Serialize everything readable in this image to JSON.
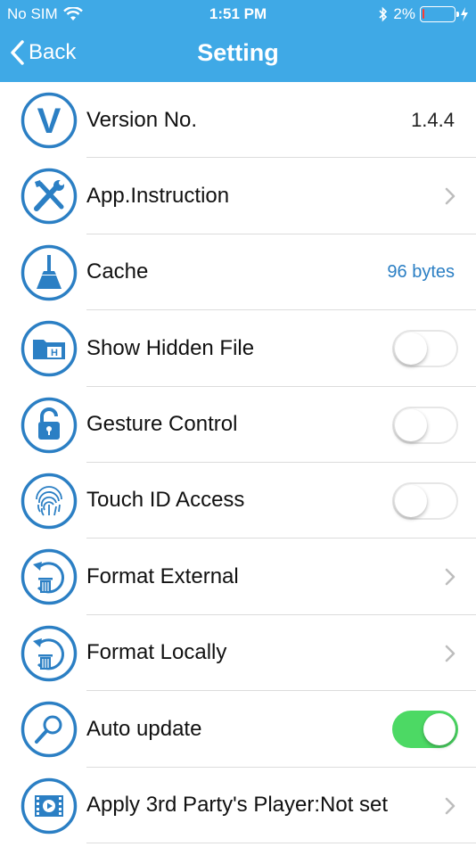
{
  "status_bar": {
    "carrier": "No SIM",
    "time": "1:51 PM",
    "battery": "2%"
  },
  "nav": {
    "back_label": "Back",
    "title": "Setting"
  },
  "rows": [
    {
      "label": "Version No.",
      "value": "1.4.4",
      "icon": "version-v-icon"
    },
    {
      "label": "App.Instruction",
      "icon": "tools-icon"
    },
    {
      "label": "Cache",
      "value": "96 bytes",
      "icon": "broom-icon"
    },
    {
      "label": "Show Hidden File",
      "toggle": false,
      "icon": "hidden-folder-icon"
    },
    {
      "label": "Gesture Control",
      "toggle": false,
      "icon": "lock-icon"
    },
    {
      "label": "Touch ID Access",
      "toggle": false,
      "icon": "fingerprint-icon"
    },
    {
      "label": "Format External",
      "icon": "format-trash-icon"
    },
    {
      "label": "Format Locally",
      "icon": "format-trash-icon"
    },
    {
      "label": "Auto update",
      "toggle": true,
      "icon": "magnifier-icon"
    },
    {
      "label": "Apply 3rd Party's Player:Not set",
      "icon": "film-player-icon"
    }
  ],
  "colors": {
    "header": "#3fa9e6",
    "icon_blue": "#2b7fc4",
    "toggle_on": "#4cd964",
    "value_blue": "#2b7fc4"
  }
}
